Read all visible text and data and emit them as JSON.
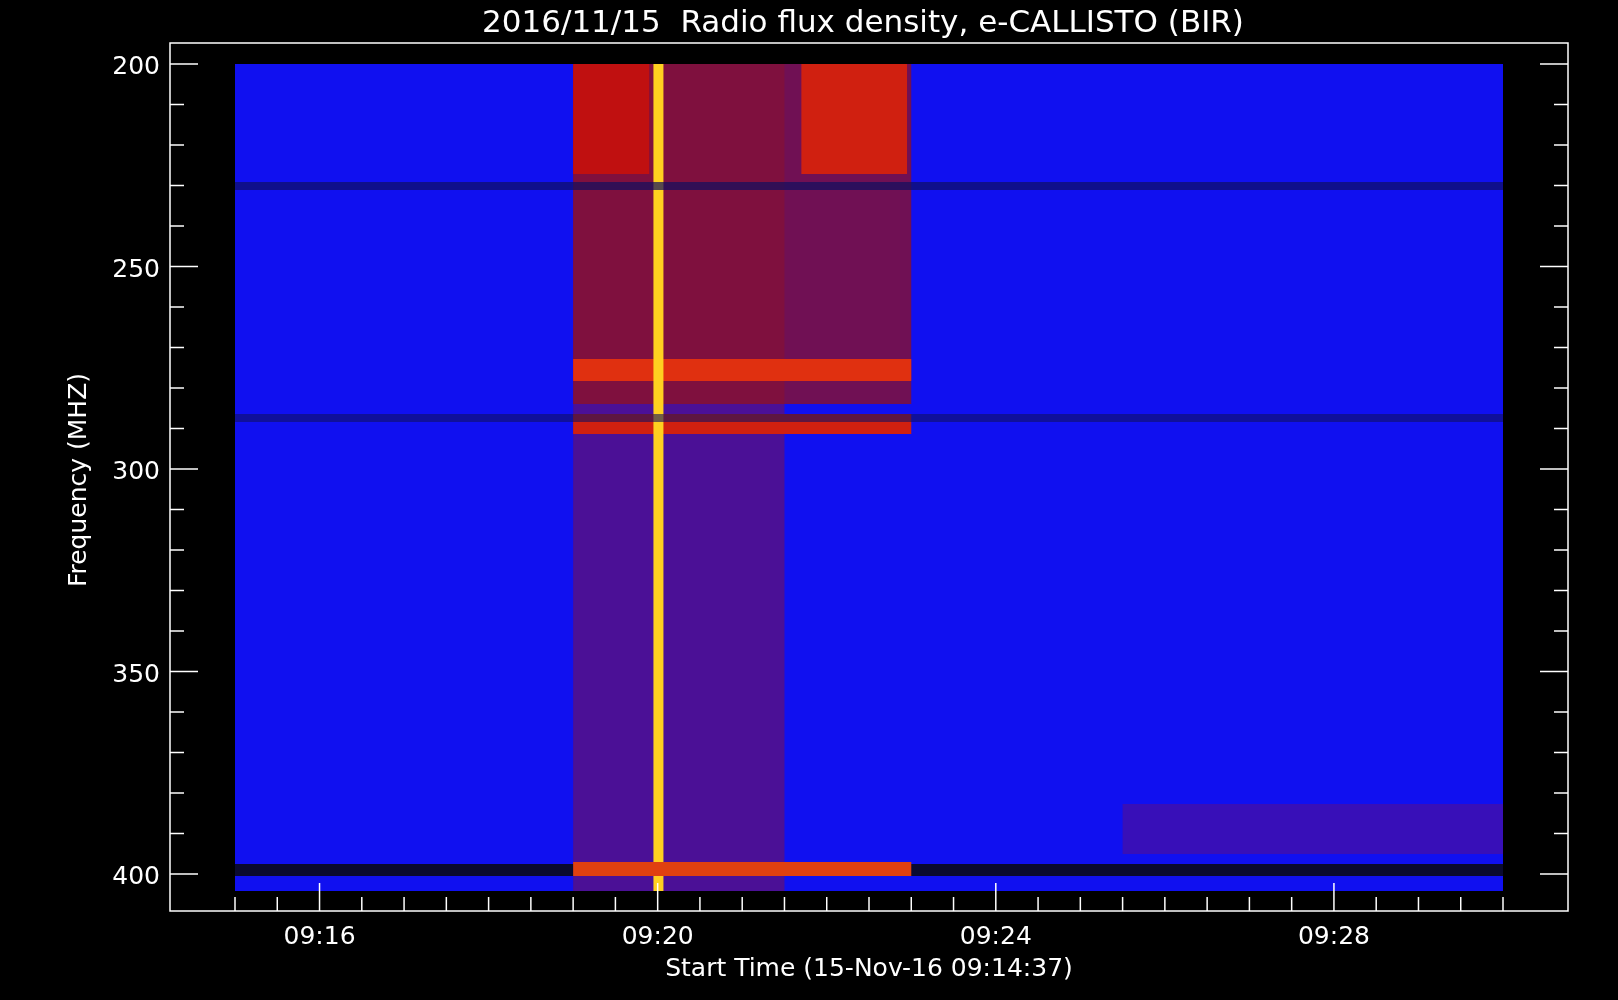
{
  "title": "2016/11/15  Radio flux density, e-CALLISTO (BIR)",
  "y_axis": {
    "label": "Frequency (MHZ)",
    "ticks": [
      "200",
      "250",
      "300",
      "350",
      "400"
    ]
  },
  "x_axis": {
    "label": "Start Time (15-Nov-16 09:14:37)",
    "ticks": [
      "09:16",
      "09:20",
      "09:24",
      "09:28"
    ]
  }
}
